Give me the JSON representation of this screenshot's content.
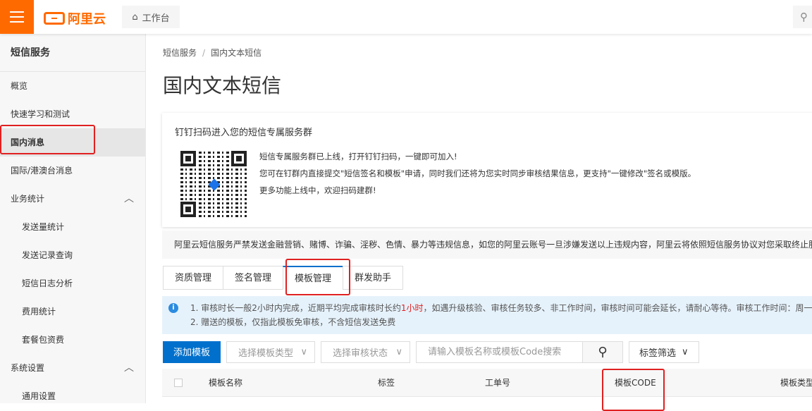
{
  "topbar": {
    "logo_text": "阿里云",
    "workbench": "工作台",
    "search_icon": "search-icon"
  },
  "sidebar": {
    "title": "短信服务",
    "items": [
      {
        "label": "概览"
      },
      {
        "label": "快速学习和测试"
      },
      {
        "label": "国内消息"
      },
      {
        "label": "国际/港澳台消息"
      },
      {
        "label": "业务统计"
      },
      {
        "label": "发送量统计"
      },
      {
        "label": "发送记录查询"
      },
      {
        "label": "短信日志分析"
      },
      {
        "label": "费用统计"
      },
      {
        "label": "套餐包资费"
      },
      {
        "label": "系统设置"
      },
      {
        "label": "通用设置"
      }
    ]
  },
  "breadcrumb": [
    "短信服务",
    "国内文本短信"
  ],
  "page_title": "国内文本短信",
  "dingtalk": {
    "title": "钉钉扫码进入您的短信专属服务群",
    "lines": [
      "短信专属服务群已上线，打开钉钉扫码，一键即可加入!",
      "您可在钉群内直接提交\"短信签名和模板\"申请，同时我们还将为您实时同步审核结果信息，更支持\"一键修改\"签名或模版。",
      "更多功能上线中，欢迎扫码建群!"
    ]
  },
  "notice": "阿里云短信服务严禁发送金融营销、赌博、诈骗、淫秽、色情、暴力等违规信息，如您的阿里云账号一旦涉嫌发送以上违规内容，阿里云将依照短信服务协议对您采取终止服",
  "tabs": [
    "资质管理",
    "签名管理",
    "模板管理",
    "群发助手"
  ],
  "info": {
    "line1_a": "1. 审核时长一般2小时内完成，近期平均完成审核时长约",
    "line1_red": "1小时",
    "line1_b": "，如遇升级核验、审核任务较多、非工作时间，审核时间可能会延长，请耐心等待。审核工作时间：周一至",
    "line2": "2. 赠送的模板，仅指此模板免审核，不含短信发送免费"
  },
  "toolbar": {
    "add": "添加模板",
    "type_placeholder": "选择模板类型",
    "status_placeholder": "选择审核状态",
    "search_placeholder": "请输入模板名称或模板Code搜索",
    "tag_filter": "标签筛选"
  },
  "table": {
    "columns": [
      "模板名称",
      "标签",
      "工单号",
      "模板CODE",
      "模板类型"
    ]
  },
  "colors": {
    "brand": "#ff6a00",
    "primary": "#0070cc",
    "annotation": "#e02020"
  }
}
